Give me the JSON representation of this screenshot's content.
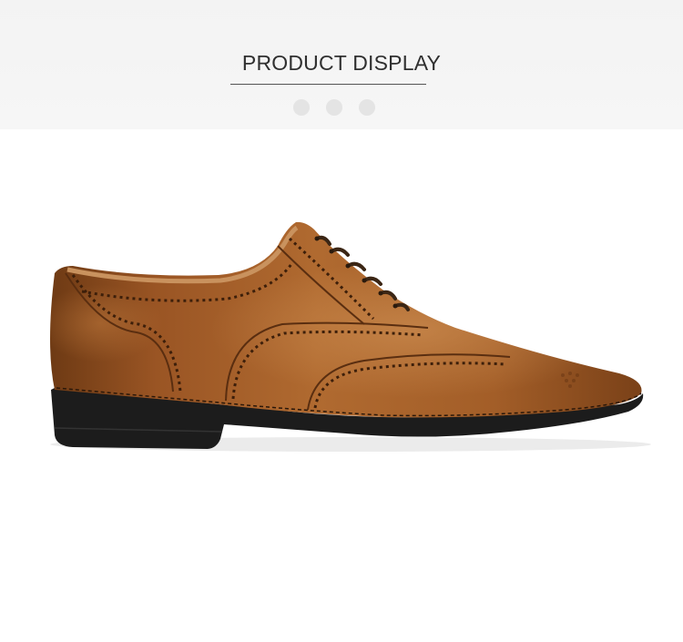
{
  "header": {
    "title": "PRODUCT DISPLAY",
    "carousel_dots": 3
  },
  "product_image": {
    "subject": "brown-leather-wingtip-oxford-shoe",
    "colors": {
      "leather_dark": "#6e3a14",
      "leather_mid": "#a5602a",
      "leather_light": "#c98a4f",
      "sole": "#1c1c1c",
      "lace": "#3b2615"
    }
  }
}
